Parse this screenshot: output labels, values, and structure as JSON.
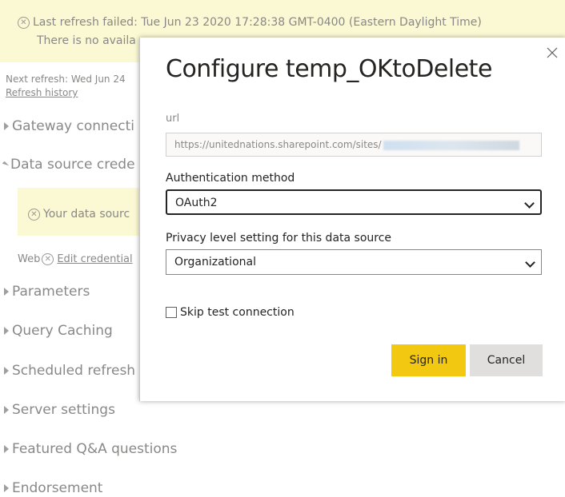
{
  "banner": {
    "line1": "Last refresh failed: Tue Jun 23 2020 17:28:38 GMT-0400 (Eastern Daylight Time)",
    "line2": "There is no availa"
  },
  "refresh": {
    "next": "Next refresh: Wed Jun 24",
    "history_link": "Refresh history"
  },
  "sections": {
    "gateway": "Gateway connecti",
    "data_source": "Data source crede",
    "parameters": "Parameters",
    "query_caching": "Query Caching",
    "scheduled_refresh": "Scheduled refresh",
    "server_settings": "Server settings",
    "featured_qa": "Featured Q&A questions",
    "endorsement": "Endorsement"
  },
  "datasource_warning": "Your data sourc",
  "web_row": {
    "prefix": "Web",
    "edit_link": "Edit credential"
  },
  "modal": {
    "title": "Configure temp_OKtoDelete",
    "url_label": "url",
    "url_value": "https://unitednations.sharepoint.com/sites/",
    "auth_label": "Authentication method",
    "auth_value": "OAuth2",
    "privacy_label": "Privacy level setting for this data source",
    "privacy_value": "Organizational",
    "skip_test_label": "Skip test connection",
    "sign_in_label": "Sign in",
    "cancel_label": "Cancel"
  },
  "colors": {
    "banner_bg": "#fbf8d4",
    "primary_button": "#f2c811",
    "secondary_button": "#e1dfdd"
  }
}
